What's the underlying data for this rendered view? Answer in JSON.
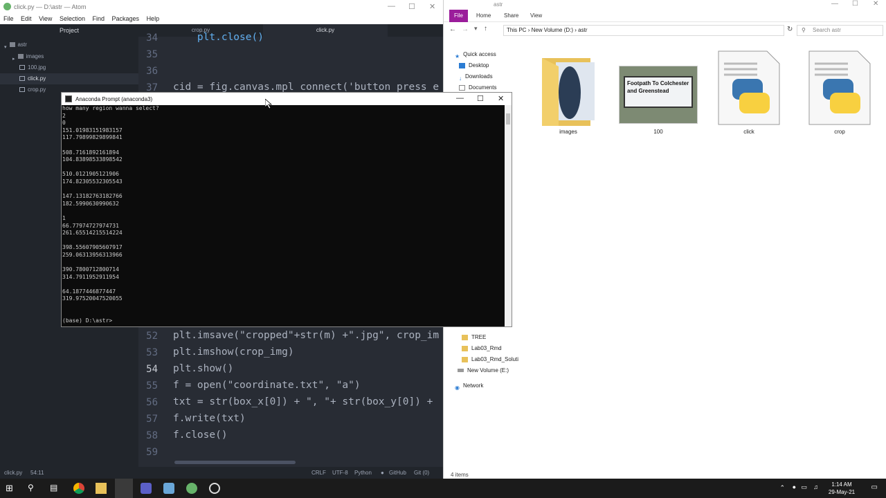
{
  "atom": {
    "title": "click.py — D:\\astr — Atom",
    "menu": [
      "File",
      "Edit",
      "View",
      "Selection",
      "Find",
      "Packages",
      "Help"
    ],
    "tree_header": "Project",
    "tree": [
      {
        "label": "astr",
        "kind": "root"
      },
      {
        "label": "images",
        "kind": "folder"
      },
      {
        "label": "100.jpg",
        "kind": "file"
      },
      {
        "label": "click.py",
        "kind": "file",
        "selected": true
      },
      {
        "label": "crop.py",
        "kind": "file"
      }
    ],
    "tabs": [
      "crop.py",
      "click.py"
    ],
    "active_tab": "click.py",
    "code_top": [
      {
        "num": "34",
        "text": "    plt.close()"
      },
      {
        "num": "35",
        "text": ""
      },
      {
        "num": "36",
        "text": ""
      },
      {
        "num": "37",
        "text": "cid = fig.canvas.mpl_connect('button_press_e"
      }
    ],
    "code_bottom": [
      {
        "num": "52",
        "text": "plt.imsave(\"cropped\"+str(m) +\".jpg\", crop_im"
      },
      {
        "num": "53",
        "text": "plt.imshow(crop_img)"
      },
      {
        "num": "54",
        "text": "plt.show()"
      },
      {
        "num": "55",
        "text": "f = open(\"coordinate.txt\", \"a\")"
      },
      {
        "num": "56",
        "text": "txt = str(box_x[0]) + \", \"+ str(box_y[0]) +"
      },
      {
        "num": "57",
        "text": "f.write(txt)"
      },
      {
        "num": "58",
        "text": "f.close()"
      },
      {
        "num": "59",
        "text": ""
      }
    ],
    "status": {
      "file": "click.py",
      "cursor": "54:11",
      "line_ending": "CRLF",
      "encoding": "UTF-8",
      "grammar": "Python",
      "github": "GitHub",
      "git": "Git (0)"
    }
  },
  "explorer": {
    "title": "astr",
    "ribbon": [
      "File",
      "Home",
      "Share",
      "View"
    ],
    "address": [
      "This PC",
      "New Volume (D:)",
      "astr"
    ],
    "search_placeholder": "Search astr",
    "nav": [
      "Quick access",
      "Desktop",
      "Downloads",
      "Documents"
    ],
    "nav_bottom": [
      "TREE",
      "Lab03_Rmd",
      "Lab03_Rmd_Soluti",
      "New Volume (E:)",
      "Network"
    ],
    "files": [
      {
        "label": "images",
        "kind": "folder"
      },
      {
        "label": "100",
        "kind": "image"
      },
      {
        "label": "click",
        "kind": "python"
      },
      {
        "label": "crop",
        "kind": "python"
      }
    ],
    "thumb_text": "Footpath To Colchester and Greenstead",
    "item_count": "4 items"
  },
  "conda": {
    "title": "Anaconda Prompt (anaconda3)",
    "output": "how many region wanna select?\n2\n0\n151.01983151983157\n117.79899829899841\n\n508.7161892161894\n104.83898533898542\n\n510.0121905121906\n174.82305532305543\n\n147.13182763182766\n182.5990630990632\n\n1\n66.77974727974731\n261.65514215514224\n\n398.55607905607917\n259.06313956313966\n\n390.7800712800714\n314.7911952911954\n\n64.1877446877447\n319.97520047520055\n\n\n(base) D:\\astr>"
  },
  "taskbar": {
    "time": "1:14 AM",
    "date": "29-May-21"
  }
}
